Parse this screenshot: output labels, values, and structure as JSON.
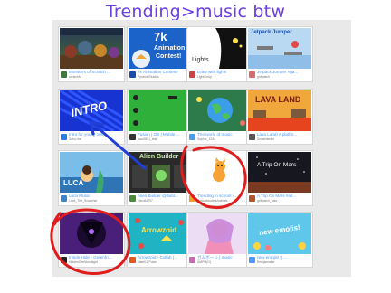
{
  "header": {
    "title": "Trending>music btw"
  },
  "cards": [
    {
      "title": "Monsters of Scratch ...",
      "author": "scratchM",
      "thumb": "monsters",
      "avatar_color": "#3b7a3b"
    },
    {
      "title": "7k Animation Contest!",
      "author": "PyramidStudios",
      "thumb": "animation-contest",
      "avatar_color": "#1a4ea8",
      "thumb_big": "7k",
      "thumb_line1": "Animation",
      "thumb_line2": "Contest!"
    },
    {
      "title": "Draw with lights",
      "author": "LightOnUp",
      "thumb": "lights",
      "avatar_color": "#c44",
      "thumb_text": "Lights"
    },
    {
      "title": "Jetpack Jumper #ga...",
      "author": "griffpatch",
      "thumb": "jetpack",
      "avatar_color": "#d86b6b",
      "thumb_text": "Jetpack Jumper"
    },
    {
      "title": "Intro for you! || 100...",
      "author": "Sobu-ma",
      "thumb": "intro",
      "avatar_color": "#2a7ee0",
      "thumb_text": "INTRO"
    },
    {
      "title": "Fusion | OS | Mobile ...",
      "author": "taco0801_test",
      "thumb": "fusion",
      "avatar_color": "#333"
    },
    {
      "title": "The world of music",
      "author": "Sophie_1234",
      "thumb": "world-music",
      "avatar_color": "#4aa0e6"
    },
    {
      "title": "Lava Land! A platfor...",
      "author": "Scratchteam",
      "thumb": "lava-land",
      "avatar_color": "#555",
      "thumb_text": "LAVA LAND"
    },
    {
      "title": "Luca Music",
      "author": "Luca_The_Scratcher",
      "thumb": "luca",
      "avatar_color": "#3a86c8",
      "thumb_text": "LUCA"
    },
    {
      "title": "Alien Builder @Bubl...",
      "author": "Hero64797",
      "thumb": "alien-builder",
      "avatar_color": "#4f8a3c",
      "thumb_text": "Alien Builder"
    },
    {
      "title": "Trending in school i...",
      "author": "SchoolstudentAnimals",
      "thumb": "scratch-cat",
      "avatar_color": "#f29a2e"
    },
    {
      "title": "A Trip On Mars #all...",
      "author": "griffpatch_tutor",
      "thumb": "mars",
      "avatar_color": "#b5532b",
      "thumb_text": "A Trip On Mars"
    },
    {
      "title": "Inside Hide - Greenfri...",
      "author": "HiddenOneMoonlight",
      "thumb": "inside-hide",
      "avatar_color": "#222"
    },
    {
      "title": "Arrowzoid - Collab (...",
      "author": "JakeK1-Pulse",
      "thumb": "arrowzoid",
      "avatar_color": "#e05a1f",
      "thumb_text": "Arrowzoid"
    },
    {
      "title": "ガムボール | music",
      "author": "AMPM(G)",
      "thumb": "anime",
      "avatar_color": "#c86ab0"
    },
    {
      "title": "new emojis! || ...",
      "author": "Emojismaker",
      "thumb": "emojis",
      "avatar_color": "#4d97ff",
      "thumb_text": "new emojis!"
    }
  ]
}
